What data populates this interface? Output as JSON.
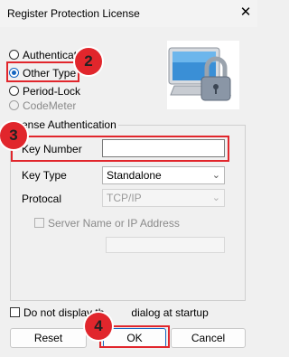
{
  "window": {
    "title": "Register Protection License",
    "close_glyph": "✕"
  },
  "license_options": [
    {
      "label": "Authenticati",
      "selected": false,
      "enabled": true
    },
    {
      "label": "Other Type",
      "selected": true,
      "enabled": true
    },
    {
      "label": "Period-Lock",
      "selected": false,
      "enabled": true
    },
    {
      "label": "CodeMeter",
      "selected": false,
      "enabled": false
    }
  ],
  "group": {
    "legend": "ense Authentication",
    "key_number_label": "Key Number",
    "key_number_value": "",
    "key_type_label": "Key Type",
    "key_type_value": "Standalone",
    "protocol_label": "Protocal",
    "protocol_value": "TCP/IP",
    "server_checkbox_label": "Server Name or IP Address",
    "server_value": ""
  },
  "startup_checkbox_label": "Do not display th",
  "startup_checkbox_label_tail": "dialog at startup",
  "buttons": {
    "reset": "Reset",
    "ok": "OK",
    "cancel": "Cancel"
  },
  "annotations": {
    "badge2": "2",
    "badge3": "3",
    "badge4": "4"
  },
  "colors": {
    "highlight": "#e1262c",
    "accent": "#1565c0"
  }
}
